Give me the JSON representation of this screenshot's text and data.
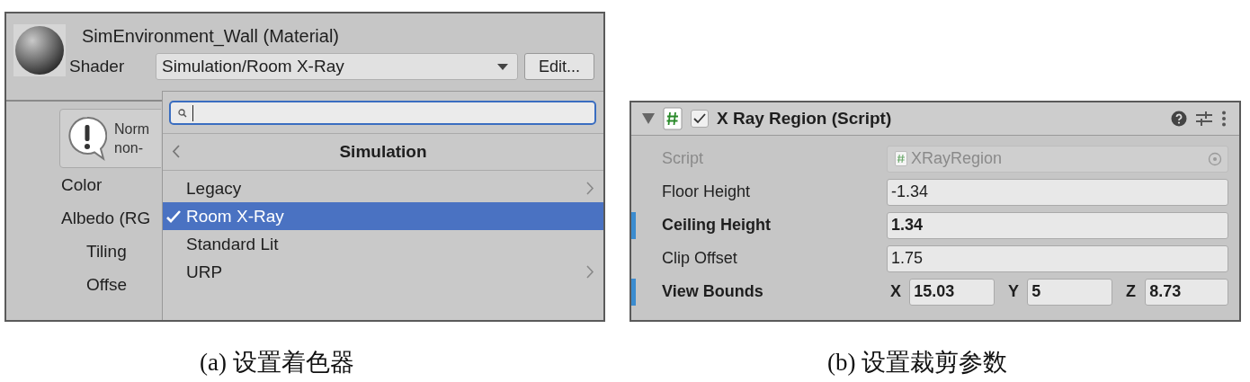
{
  "material_panel": {
    "title": "SimEnvironment_Wall (Material)",
    "shader_label": "Shader",
    "shader_value": "Simulation/Room X-Ray",
    "edit_button": "Edit...",
    "warning_lines": [
      "Norm",
      "non-"
    ],
    "properties": [
      {
        "label": "Color"
      },
      {
        "label": "Albedo (RG",
        "children": [
          {
            "label": "Tiling"
          },
          {
            "label": "Offse"
          }
        ]
      }
    ],
    "dropdown": {
      "header": "Simulation",
      "items": [
        {
          "label": "Legacy",
          "selected": false,
          "submenu": true
        },
        {
          "label": "Room X-Ray",
          "selected": true,
          "submenu": false
        },
        {
          "label": "Standard Lit",
          "selected": false,
          "submenu": false
        },
        {
          "label": "URP",
          "selected": false,
          "submenu": true
        }
      ]
    }
  },
  "script_panel": {
    "title": "X Ray Region (Script)",
    "expanded": true,
    "enabled": true,
    "fields": [
      {
        "kind": "object",
        "label": "Script",
        "value": "XRayRegion",
        "disabled": true,
        "modified": false
      },
      {
        "kind": "float",
        "label": "Floor Height",
        "value": "-1.34",
        "disabled": false,
        "modified": false
      },
      {
        "kind": "float",
        "label": "Ceiling Height",
        "value": "1.34",
        "disabled": false,
        "modified": true
      },
      {
        "kind": "float",
        "label": "Clip Offset",
        "value": "1.75",
        "disabled": false,
        "modified": false
      },
      {
        "kind": "vector3",
        "label": "View Bounds",
        "disabled": false,
        "modified": true,
        "components": [
          {
            "axis": "X",
            "value": "15.03"
          },
          {
            "axis": "Y",
            "value": "5"
          },
          {
            "axis": "Z",
            "value": "8.73"
          }
        ]
      }
    ]
  },
  "captions": [
    "(a) 设置着色器",
    "(b) 设置裁剪参数"
  ]
}
